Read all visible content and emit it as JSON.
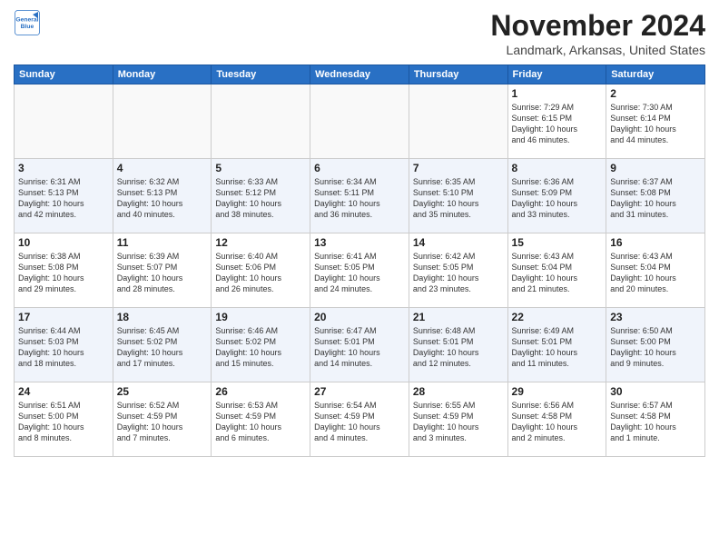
{
  "logo": {
    "line1": "General",
    "line2": "Blue"
  },
  "header": {
    "month": "November 2024",
    "location": "Landmark, Arkansas, United States"
  },
  "weekdays": [
    "Sunday",
    "Monday",
    "Tuesday",
    "Wednesday",
    "Thursday",
    "Friday",
    "Saturday"
  ],
  "weeks": [
    [
      {
        "day": "",
        "info": ""
      },
      {
        "day": "",
        "info": ""
      },
      {
        "day": "",
        "info": ""
      },
      {
        "day": "",
        "info": ""
      },
      {
        "day": "",
        "info": ""
      },
      {
        "day": "1",
        "info": "Sunrise: 7:29 AM\nSunset: 6:15 PM\nDaylight: 10 hours\nand 46 minutes."
      },
      {
        "day": "2",
        "info": "Sunrise: 7:30 AM\nSunset: 6:14 PM\nDaylight: 10 hours\nand 44 minutes."
      }
    ],
    [
      {
        "day": "3",
        "info": "Sunrise: 6:31 AM\nSunset: 5:13 PM\nDaylight: 10 hours\nand 42 minutes."
      },
      {
        "day": "4",
        "info": "Sunrise: 6:32 AM\nSunset: 5:13 PM\nDaylight: 10 hours\nand 40 minutes."
      },
      {
        "day": "5",
        "info": "Sunrise: 6:33 AM\nSunset: 5:12 PM\nDaylight: 10 hours\nand 38 minutes."
      },
      {
        "day": "6",
        "info": "Sunrise: 6:34 AM\nSunset: 5:11 PM\nDaylight: 10 hours\nand 36 minutes."
      },
      {
        "day": "7",
        "info": "Sunrise: 6:35 AM\nSunset: 5:10 PM\nDaylight: 10 hours\nand 35 minutes."
      },
      {
        "day": "8",
        "info": "Sunrise: 6:36 AM\nSunset: 5:09 PM\nDaylight: 10 hours\nand 33 minutes."
      },
      {
        "day": "9",
        "info": "Sunrise: 6:37 AM\nSunset: 5:08 PM\nDaylight: 10 hours\nand 31 minutes."
      }
    ],
    [
      {
        "day": "10",
        "info": "Sunrise: 6:38 AM\nSunset: 5:08 PM\nDaylight: 10 hours\nand 29 minutes."
      },
      {
        "day": "11",
        "info": "Sunrise: 6:39 AM\nSunset: 5:07 PM\nDaylight: 10 hours\nand 28 minutes."
      },
      {
        "day": "12",
        "info": "Sunrise: 6:40 AM\nSunset: 5:06 PM\nDaylight: 10 hours\nand 26 minutes."
      },
      {
        "day": "13",
        "info": "Sunrise: 6:41 AM\nSunset: 5:05 PM\nDaylight: 10 hours\nand 24 minutes."
      },
      {
        "day": "14",
        "info": "Sunrise: 6:42 AM\nSunset: 5:05 PM\nDaylight: 10 hours\nand 23 minutes."
      },
      {
        "day": "15",
        "info": "Sunrise: 6:43 AM\nSunset: 5:04 PM\nDaylight: 10 hours\nand 21 minutes."
      },
      {
        "day": "16",
        "info": "Sunrise: 6:43 AM\nSunset: 5:04 PM\nDaylight: 10 hours\nand 20 minutes."
      }
    ],
    [
      {
        "day": "17",
        "info": "Sunrise: 6:44 AM\nSunset: 5:03 PM\nDaylight: 10 hours\nand 18 minutes."
      },
      {
        "day": "18",
        "info": "Sunrise: 6:45 AM\nSunset: 5:02 PM\nDaylight: 10 hours\nand 17 minutes."
      },
      {
        "day": "19",
        "info": "Sunrise: 6:46 AM\nSunset: 5:02 PM\nDaylight: 10 hours\nand 15 minutes."
      },
      {
        "day": "20",
        "info": "Sunrise: 6:47 AM\nSunset: 5:01 PM\nDaylight: 10 hours\nand 14 minutes."
      },
      {
        "day": "21",
        "info": "Sunrise: 6:48 AM\nSunset: 5:01 PM\nDaylight: 10 hours\nand 12 minutes."
      },
      {
        "day": "22",
        "info": "Sunrise: 6:49 AM\nSunset: 5:01 PM\nDaylight: 10 hours\nand 11 minutes."
      },
      {
        "day": "23",
        "info": "Sunrise: 6:50 AM\nSunset: 5:00 PM\nDaylight: 10 hours\nand 9 minutes."
      }
    ],
    [
      {
        "day": "24",
        "info": "Sunrise: 6:51 AM\nSunset: 5:00 PM\nDaylight: 10 hours\nand 8 minutes."
      },
      {
        "day": "25",
        "info": "Sunrise: 6:52 AM\nSunset: 4:59 PM\nDaylight: 10 hours\nand 7 minutes."
      },
      {
        "day": "26",
        "info": "Sunrise: 6:53 AM\nSunset: 4:59 PM\nDaylight: 10 hours\nand 6 minutes."
      },
      {
        "day": "27",
        "info": "Sunrise: 6:54 AM\nSunset: 4:59 PM\nDaylight: 10 hours\nand 4 minutes."
      },
      {
        "day": "28",
        "info": "Sunrise: 6:55 AM\nSunset: 4:59 PM\nDaylight: 10 hours\nand 3 minutes."
      },
      {
        "day": "29",
        "info": "Sunrise: 6:56 AM\nSunset: 4:58 PM\nDaylight: 10 hours\nand 2 minutes."
      },
      {
        "day": "30",
        "info": "Sunrise: 6:57 AM\nSunset: 4:58 PM\nDaylight: 10 hours\nand 1 minute."
      }
    ]
  ]
}
